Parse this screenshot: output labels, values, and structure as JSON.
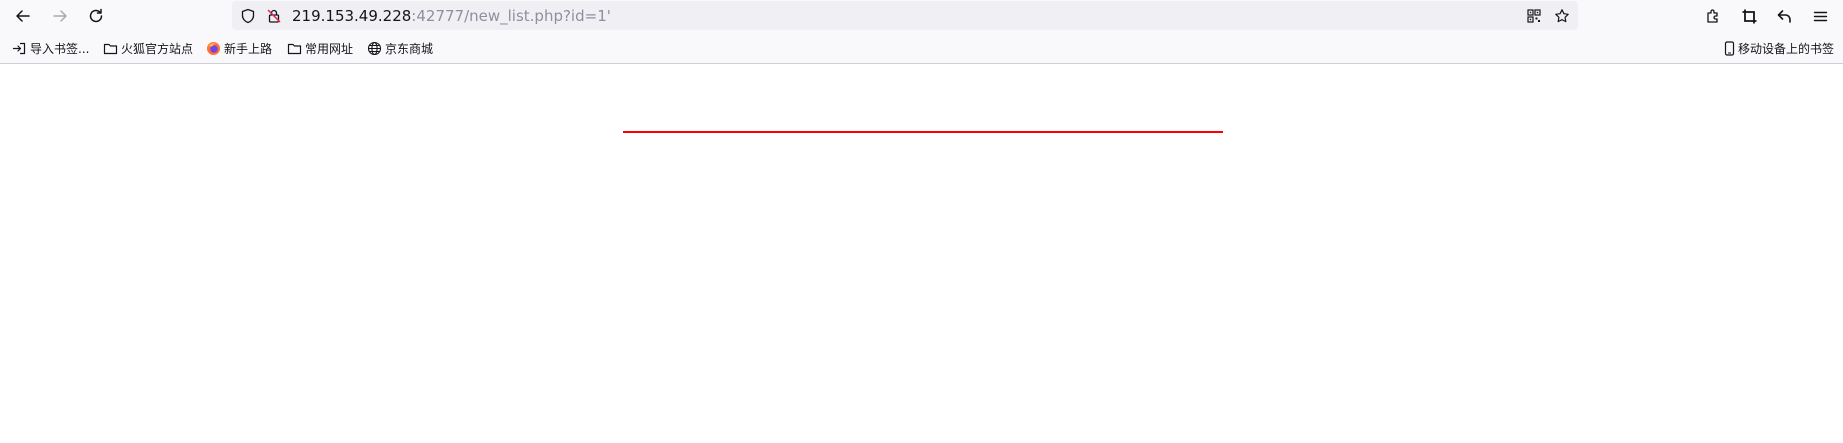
{
  "toolbar": {
    "back": "back-arrow",
    "forward": "forward-arrow",
    "reload": "reload"
  },
  "urlbar": {
    "host": "219.153.49.228",
    "rest": ":42777/new_list.php?id=1'"
  },
  "bookmarks": {
    "items": [
      {
        "label": "导入书签...",
        "icon": "import-icon"
      },
      {
        "label": "火狐官方站点",
        "icon": "folder-icon"
      },
      {
        "label": "新手上路",
        "icon": "firefox-icon"
      },
      {
        "label": "常用网址",
        "icon": "folder-icon"
      },
      {
        "label": "京东商城",
        "icon": "globe-icon"
      }
    ],
    "mobile": "移动设备上的书签"
  },
  "colors": {
    "rule": "#ff0000",
    "chrome": "#f9f9fb",
    "urlbar": "#f0f0f4"
  }
}
